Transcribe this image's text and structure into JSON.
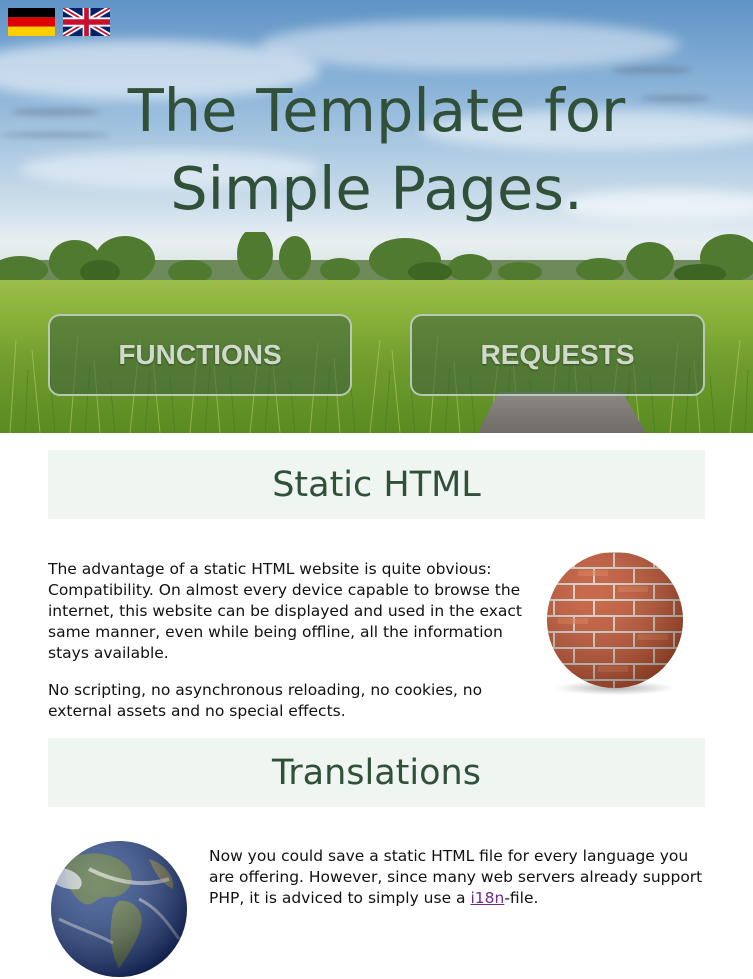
{
  "languages": [
    {
      "code": "de",
      "flag_icon": "germany-flag-icon"
    },
    {
      "code": "en",
      "flag_icon": "uk-flag-icon"
    }
  ],
  "hero": {
    "title_line1": "The Template for",
    "title_line2": "Simple Pages.",
    "buttons": {
      "functions": "FUNCTIONS",
      "requests": "REQUESTS"
    }
  },
  "sections": {
    "static_html": {
      "heading": "Static HTML",
      "paragraph1": "The advantage of a static HTML website is quite obvious: Compatibility. On almost every device capable to browse the internet, this website can be displayed and used in the exact same manner, even while being offline, all the information stays available.",
      "paragraph2": "No scripting, no asynchronous reloading, no cookies, no external assets and no special effects.",
      "image_icon": "brick-wall-image"
    },
    "translations": {
      "heading": "Translations",
      "paragraph_before_link": "Now you could save a static HTML file for every language you are offering. However, since many web servers already support PHP, it is adviced to simply use a ",
      "link_text": "i18n",
      "paragraph_after_link": "-file.",
      "image_icon": "earth-globe-image"
    }
  },
  "colors": {
    "heading_green": "#31503a",
    "section_bg": "#eff5f1",
    "link_purple": "#6a2c8f"
  }
}
